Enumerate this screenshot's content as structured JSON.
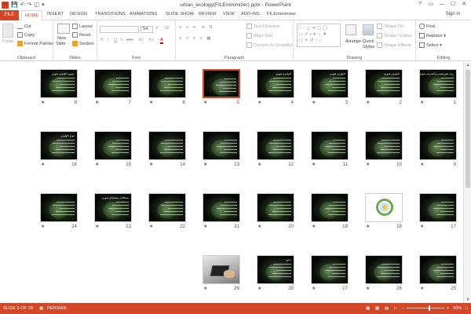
{
  "window": {
    "title": "urban_ecology(FILEminimizer).pptx - PowerPoint",
    "app_letter": "P",
    "quick_access": [
      "save-icon",
      "undo-icon",
      "redo-icon",
      "present-icon",
      "customize-icon"
    ],
    "controls": [
      "?",
      "▭",
      "—",
      "☐",
      "✕"
    ]
  },
  "tabs": {
    "file": "FILE",
    "items": [
      "HOME",
      "INSERT",
      "DESIGN",
      "TRANSITIONS",
      "ANIMATIONS",
      "SLIDE SHOW",
      "REVIEW",
      "VIEW",
      "ADD-INS",
      "FILEminimizer"
    ],
    "active": "HOME",
    "sign_in": "Sign in"
  },
  "ribbon": {
    "clipboard": {
      "label": "Clipboard",
      "paste": "Paste",
      "cut": "Cut",
      "copy": "Copy",
      "format_painter": "Format Painter"
    },
    "slides": {
      "label": "Slides",
      "new_slide": "New",
      "new_slide2": "Slide",
      "layout": "Layout",
      "reset": "Reset",
      "section": "Section"
    },
    "font": {
      "label": "Font",
      "font_name": "",
      "font_size": "54",
      "buttons": [
        "B",
        "I",
        "U",
        "S",
        "abc",
        "AV",
        "Aa",
        "A"
      ]
    },
    "paragraph": {
      "label": "Paragraph",
      "text_direction": "Text Direction",
      "align_text": "Align Text",
      "convert_smartart": "Convert to SmartArt"
    },
    "drawing": {
      "label": "Drawing",
      "arrange": "Arrange",
      "quick_styles": "Quick",
      "quick_styles2": "Styles",
      "shape_fill": "Shape Fill",
      "shape_outline": "Shape Outline",
      "shape_effects": "Shape Effects"
    },
    "editing": {
      "label": "Editing",
      "find": "Find",
      "replace": "Replace",
      "select": "Select"
    }
  },
  "slides": [
    {
      "n": "1",
      "title": "روند شهرنشینی و گسترش شهرها در دنیا"
    },
    {
      "n": "2",
      "title": "اکولوژی شهری"
    },
    {
      "n": "3",
      "title": "اکولوژی شهری"
    },
    {
      "n": "4",
      "title": "اکولوژی شهری"
    },
    {
      "n": "5",
      "title": ""
    },
    {
      "n": "6",
      "title": ""
    },
    {
      "n": "7",
      "title": ""
    },
    {
      "n": "8",
      "title": "مفهوم اکولوژی شهری"
    },
    {
      "n": "9",
      "title": ""
    },
    {
      "n": "10",
      "title": ""
    },
    {
      "n": "11",
      "title": ""
    },
    {
      "n": "12",
      "title": ""
    },
    {
      "n": "13",
      "title": ""
    },
    {
      "n": "14",
      "title": ""
    },
    {
      "n": "15",
      "title": ""
    },
    {
      "n": "16",
      "title": "انواع اکولوژی"
    },
    {
      "n": "17",
      "title": ""
    },
    {
      "n": "18",
      "title": ""
    },
    {
      "n": "19",
      "title": ""
    },
    {
      "n": "20",
      "title": ""
    },
    {
      "n": "21",
      "title": ""
    },
    {
      "n": "22",
      "title": ""
    },
    {
      "n": "23",
      "title": "مشکلات محیط‌های شهری"
    },
    {
      "n": "24",
      "title": ""
    },
    {
      "n": "25",
      "title": ""
    },
    {
      "n": "26",
      "title": ""
    },
    {
      "n": "27",
      "title": ""
    },
    {
      "n": "28",
      "title": "منابع"
    },
    {
      "n": "29",
      "title": ""
    }
  ],
  "selected_slide": "5",
  "status": {
    "slide_info": "SLIDE 5 OF 29",
    "language": "PERSIAN",
    "zoom": "50%",
    "zoom_fraction": 0.5
  }
}
